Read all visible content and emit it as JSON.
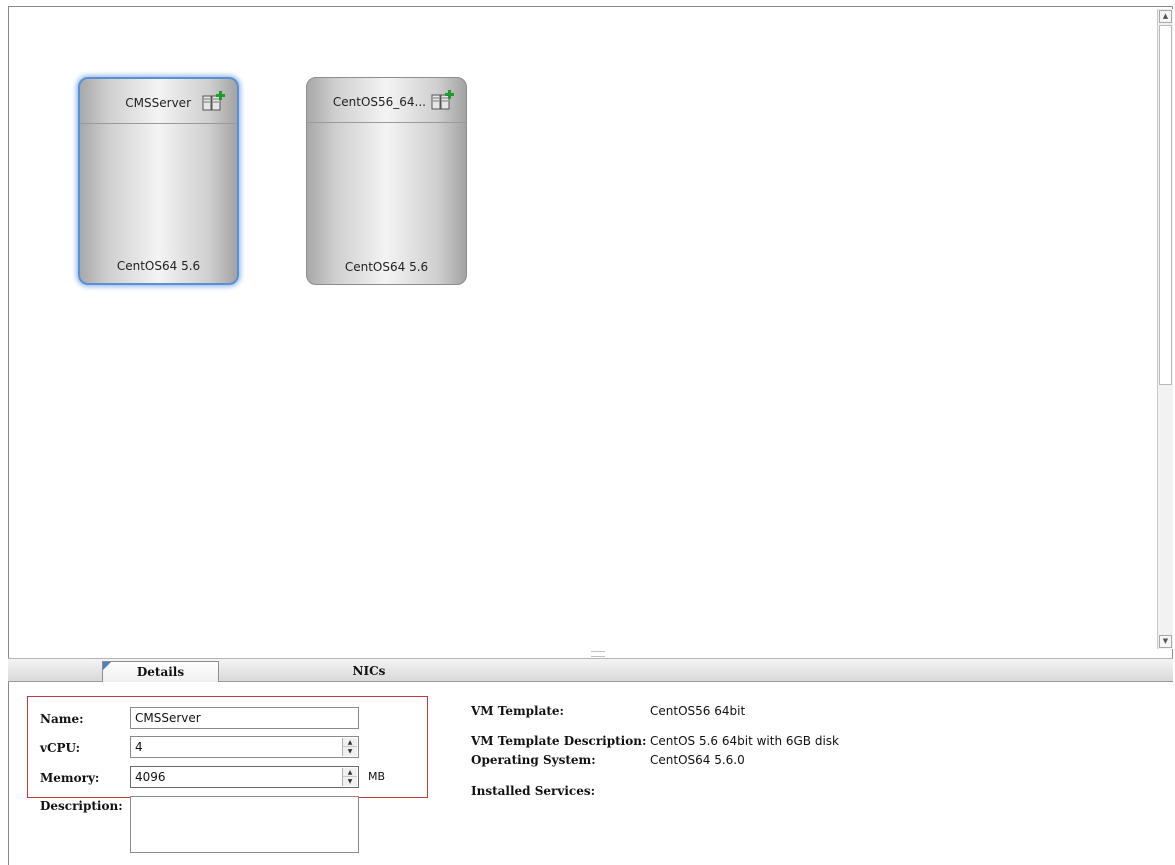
{
  "vms": [
    {
      "name": "CMSServer",
      "os": "CentOS64 5.6",
      "selected": true,
      "icon": "vm-add-icon"
    },
    {
      "name": "CentOS56_64...",
      "os": "CentOS64 5.6",
      "selected": false,
      "icon": "vm-add-icon"
    }
  ],
  "tabs": [
    {
      "label": "Details",
      "active": true
    },
    {
      "label": "NICs",
      "active": false
    }
  ],
  "details": {
    "name_label": "Name:",
    "name_value": "CMSServer",
    "vcpu_label": "vCPU:",
    "vcpu_value": "4",
    "memory_label": "Memory:",
    "memory_value": "4096",
    "memory_unit": "MB",
    "description_label": "Description:",
    "description_value": ""
  },
  "template_info": {
    "vm_template_label": "VM Template:",
    "vm_template_value": "CentOS56 64bit",
    "template_description_label": "VM Template Description:",
    "template_description_value": "CentOS 5.6 64bit with 6GB disk",
    "os_label": "Operating System:",
    "os_value": "CentOS64 5.6.0",
    "installed_services_label": "Installed Services:"
  },
  "colors": {
    "selection_border": "#5a8fd4",
    "highlight_box": "#c8373b",
    "tab_corner_accent": "#4f7fc1"
  }
}
